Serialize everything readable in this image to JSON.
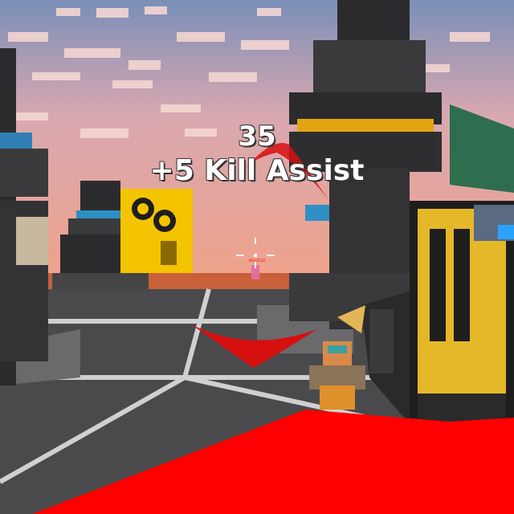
{
  "hud": {
    "score_popup": "35",
    "kill_assist_text": "+5 Kill Assist",
    "enemy_name_tag": "AGUS10"
  },
  "colors": {
    "damage_overlay": "#ff0000",
    "direction_indicator": "#e01010",
    "sky": "#e8a9a0",
    "gold_accent": "#f5c400"
  },
  "icons": [
    "crosshair-icon",
    "damage-direction-indicator-icon"
  ]
}
